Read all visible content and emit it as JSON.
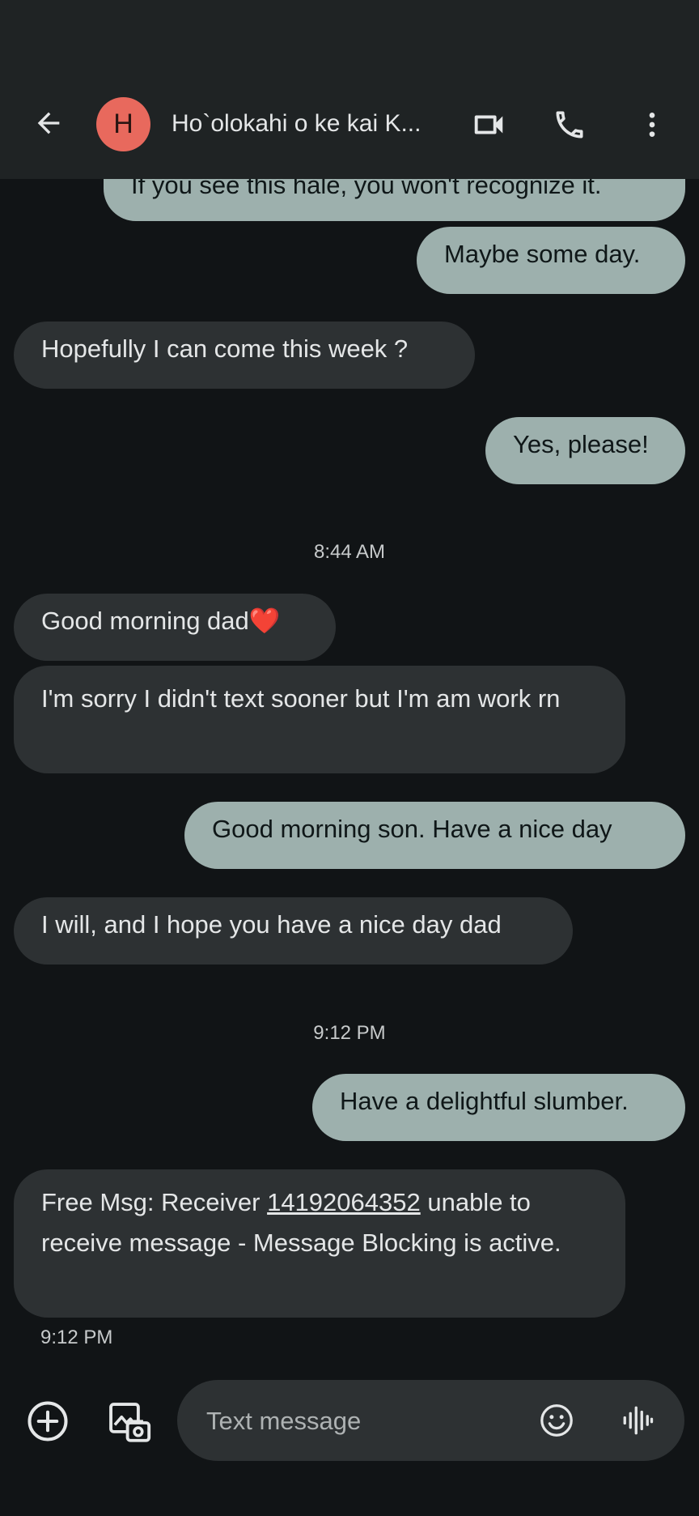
{
  "header": {
    "avatar_letter": "H",
    "title": "Ho`olokahi o ke kai K...",
    "back_icon": "arrow-left-icon",
    "video_icon": "video-call-icon",
    "phone_icon": "phone-icon",
    "more_icon": "more-vert-icon"
  },
  "messages": [
    {
      "dir": "out",
      "text": "If you see this hale, you won't recognize it."
    },
    {
      "dir": "out",
      "text": "Maybe some day."
    },
    {
      "dir": "in",
      "text": "Hopefully I can come this week ?"
    },
    {
      "dir": "out",
      "text": "Yes, please!"
    },
    {
      "dir": "in",
      "text": "Good morning dad❤️"
    },
    {
      "dir": "in",
      "text": "I'm sorry I didn't text sooner but I'm am work rn"
    },
    {
      "dir": "out",
      "text": "Good morning son. Have a nice day"
    },
    {
      "dir": "in",
      "text": "I will, and I hope you have a nice day dad"
    },
    {
      "dir": "out",
      "text": "Have a delightful slumber."
    },
    {
      "dir": "in",
      "text_before": "Free Msg: Receiver ",
      "link": "14192064352",
      "text_after": " unable to receive message - Message Blocking is active."
    }
  ],
  "timestamps": {
    "t1": "8:44 AM",
    "t2": "9:12 PM",
    "last_meta": "9:12 PM"
  },
  "compose": {
    "placeholder": "Text message",
    "add_icon": "add-circle-icon",
    "gallery_icon": "gallery-camera-icon",
    "emoji_icon": "emoji-icon",
    "voice_icon": "voice-waveform-icon"
  },
  "colors": {
    "background": "#111416",
    "appbar": "#1f2324",
    "outgoing_bubble": "#9db0ad",
    "incoming_bubble": "#2d3133",
    "avatar": "#e8695d"
  }
}
